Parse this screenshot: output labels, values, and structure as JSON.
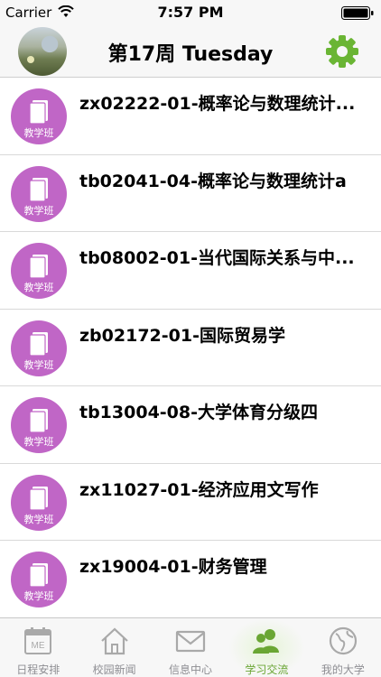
{
  "status_bar": {
    "carrier": "Carrier",
    "time": "7:57 PM"
  },
  "nav": {
    "title": "第17周 Tuesday",
    "settings_icon": "gear-icon",
    "accent": "#6ab534"
  },
  "badge": {
    "label": "教学班",
    "color": "#c066c6",
    "icon": "book-icon"
  },
  "courses": [
    {
      "title": "zx02222-01-概率论与数理统计..."
    },
    {
      "title": "tb02041-04-概率论与数理统计a"
    },
    {
      "title": "tb08002-01-当代国际关系与中..."
    },
    {
      "title": "zb02172-01-国际贸易学"
    },
    {
      "title": "tb13004-08-大学体育分级四"
    },
    {
      "title": "zx11027-01-经济应用文写作"
    },
    {
      "title": "zx19004-01-财务管理"
    }
  ],
  "tabs": [
    {
      "label": "日程安排",
      "icon": "calendar-icon"
    },
    {
      "label": "校园新闻",
      "icon": "house-icon"
    },
    {
      "label": "信息中心",
      "icon": "envelope-icon"
    },
    {
      "label": "学习交流",
      "icon": "people-icon",
      "active": true
    },
    {
      "label": "我的大学",
      "icon": "globe-icon"
    }
  ],
  "calendar_icon_text": "ME"
}
